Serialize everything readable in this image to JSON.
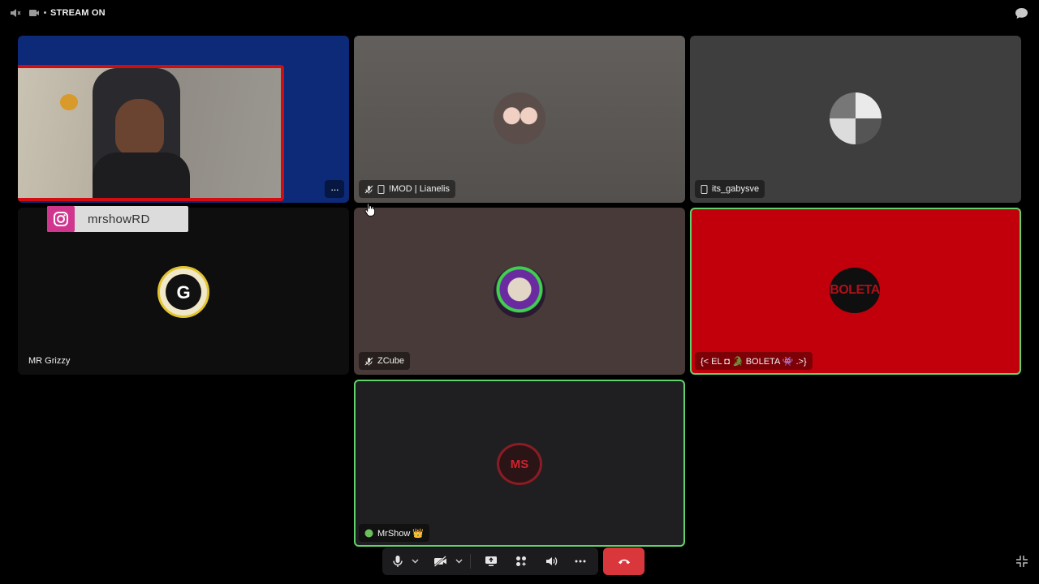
{
  "topbar": {
    "stream_label": "STREAM ON",
    "speaker_icon": "speaker-muted-icon",
    "camera_icon": "stream-camera-icon",
    "chat_icon": "chat-icon"
  },
  "tiles": {
    "streamer": {
      "more_label": "···",
      "bg": "#0c2a78"
    },
    "lianelis": {
      "name": "!MOD | Lianelis",
      "muted": true,
      "mobile": true,
      "bg": "#5b5855"
    },
    "gabysve": {
      "name": "its_gabysve",
      "mobile": true,
      "bg": "#3e3e3e"
    },
    "grizzy": {
      "name": "MR Grizzy",
      "bg": "#0e0e0e"
    },
    "zcube": {
      "name": "ZCube",
      "muted": true,
      "bg": "#473a38"
    },
    "boleta": {
      "name": "{< EL ◘ 🐊 BOLETA 👾 .>}",
      "bg": "#c2000b",
      "speaking": true,
      "avatar_text": "BOLETA"
    },
    "mrshow": {
      "name": "MrShow 👑",
      "bg": "#1f1f21",
      "speaking": true,
      "avatar_text": "MS"
    }
  },
  "overlay": {
    "instagram_handle": "mrshowRD",
    "instagram_color": "#d1368f"
  },
  "controls": {
    "mic": "microphone-icon",
    "camera": "camera-off-icon",
    "screen": "screen-share-icon",
    "activities": "activities-icon",
    "soundboard": "soundboard-icon",
    "more": "more-icon",
    "hangup": "hang-up-icon",
    "hangup_color": "#da373c",
    "speaking_color": "#5fd36b"
  }
}
